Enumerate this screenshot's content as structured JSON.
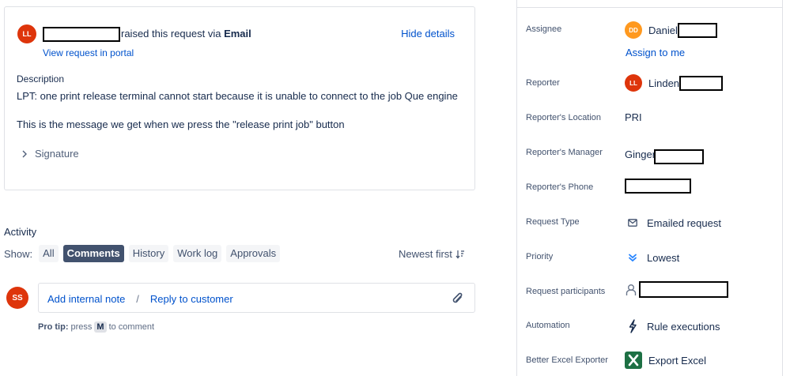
{
  "request": {
    "reporter_initials": "LL",
    "raised_text": "raised this request via",
    "channel": "Email",
    "view_portal_label": "View request in portal",
    "hide_details_label": "Hide details",
    "description_label": "Description",
    "description_line1": "LPT: one print release terminal cannot start because it is unable to connect to the job Que engine",
    "description_line2": "This is the message we get when we press the \"release print job\" button",
    "signature_label": "Signature"
  },
  "activity": {
    "title": "Activity",
    "show_label": "Show:",
    "filters": [
      "All",
      "Comments",
      "History",
      "Work log",
      "Approvals"
    ],
    "active_filter": "Comments",
    "sort_label": "Newest first",
    "commenter_initials": "SS",
    "add_note_label": "Add internal note",
    "separator": "/",
    "reply_label": "Reply to customer",
    "pro_tip_label": "Pro tip:",
    "pro_tip_press": "press",
    "pro_tip_key": "M",
    "pro_tip_suffix": "to comment"
  },
  "details": {
    "assignee_label": "Assignee",
    "assignee_initials": "DD",
    "assignee_name": "Daniel",
    "assign_to_me": "Assign to me",
    "reporter_label": "Reporter",
    "reporter_initials": "LL",
    "reporter_name": "Linden",
    "location_label": "Reporter's Location",
    "location_value": "PRI",
    "manager_label": "Reporter's Manager",
    "manager_name": "Ginger",
    "phone_label": "Reporter's Phone",
    "request_type_label": "Request Type",
    "request_type_value": "Emailed request",
    "priority_label": "Priority",
    "priority_value": "Lowest",
    "participants_label": "Request participants",
    "automation_label": "Automation",
    "automation_value": "Rule executions",
    "exporter_label": "Better Excel Exporter",
    "exporter_value": "Export Excel"
  },
  "colors": {
    "link": "#0052cc",
    "avatar_red": "#de350b",
    "avatar_orange": "#ff991f",
    "active_filter_bg": "#42526e",
    "priority_blue": "#2684ff",
    "excel_green": "#1d7044"
  },
  "icons": {
    "signature_chevron": "chevron-right-icon",
    "sort": "sort-descending-icon",
    "attach": "paperclip-icon",
    "request_type": "mail-icon",
    "priority": "priority-lowest-icon",
    "participants": "person-icon",
    "automation": "lightning-icon",
    "exporter": "excel-icon"
  }
}
